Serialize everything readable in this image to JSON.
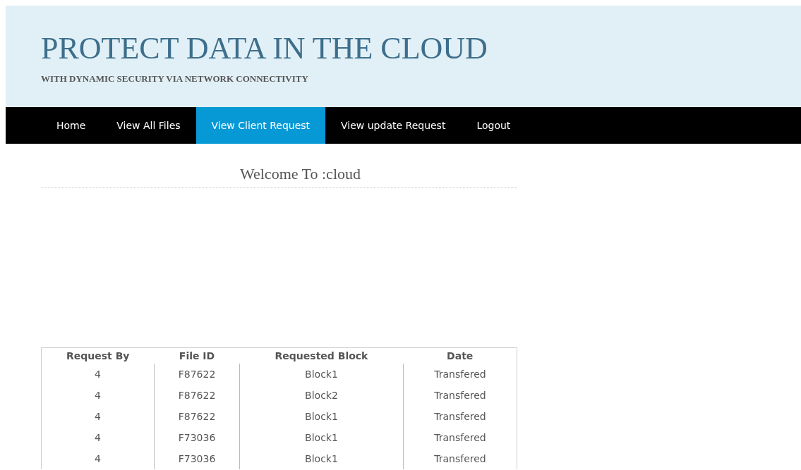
{
  "header": {
    "title": "PROTECT DATA IN THE CLOUD",
    "subtitle": "WITH DYNAMIC SECURITY VIA NETWORK CONNECTIVITY"
  },
  "nav": [
    {
      "label": "Home",
      "selected": false
    },
    {
      "label": "View All Files",
      "selected": false
    },
    {
      "label": "View Client Request",
      "selected": true
    },
    {
      "label": "View update Request",
      "selected": false
    },
    {
      "label": "Logout",
      "selected": false
    }
  ],
  "welcome": "Welcome To :cloud",
  "table": {
    "columns": [
      "Request By",
      "File ID",
      "Requested Block",
      "Date"
    ],
    "rows": [
      [
        "4",
        "F87622",
        "Block1",
        "Transfered"
      ],
      [
        "4",
        "F87622",
        "Block2",
        "Transfered"
      ],
      [
        "4",
        "F87622",
        "Block1",
        "Transfered"
      ],
      [
        "4",
        "F73036",
        "Block1",
        "Transfered"
      ],
      [
        "4",
        "F73036",
        "Block1",
        "Transfered"
      ]
    ]
  }
}
